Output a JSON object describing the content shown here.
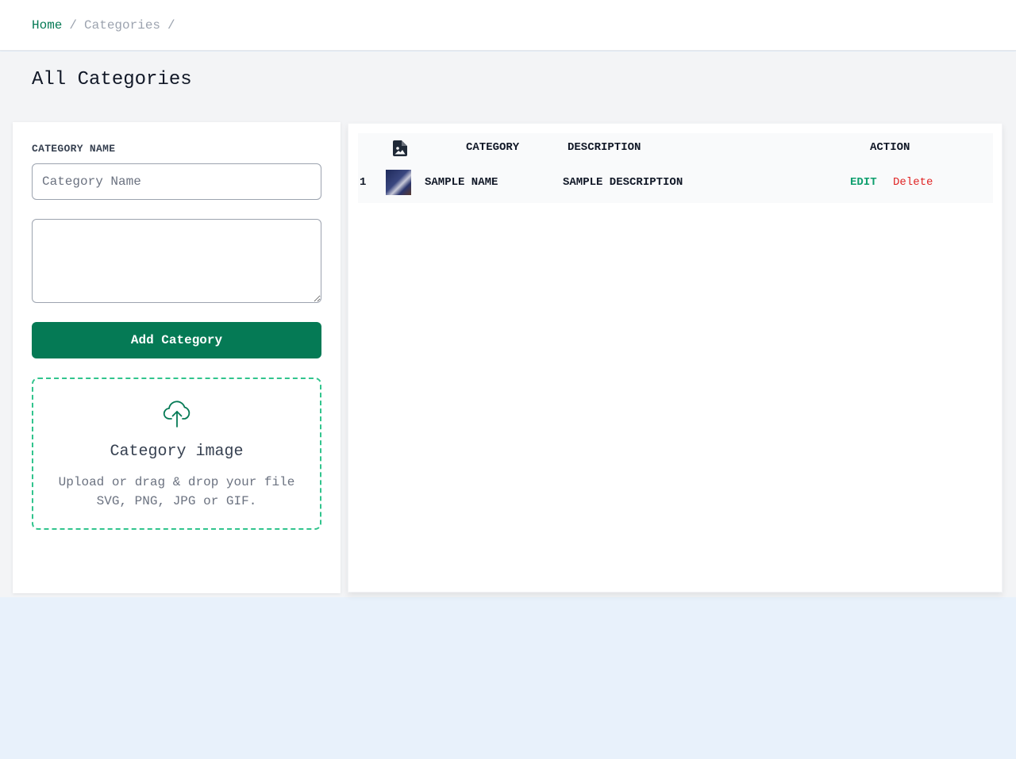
{
  "breadcrumb": {
    "home": "Home",
    "separator": "/",
    "current": "Categories"
  },
  "page": {
    "title": "All Categories"
  },
  "form": {
    "name_label": "CATEGORY NAME",
    "name_placeholder": "Category Name",
    "name_value": "",
    "description_value": "",
    "submit_label": "Add Category"
  },
  "upload": {
    "icon": "cloud-upload-icon",
    "title": "Category image",
    "hint_line1": "Upload or drag & drop your file",
    "hint_line2": "SVG, PNG, JPG or GIF."
  },
  "table": {
    "columns": {
      "image_icon": "image-file-icon",
      "category": "CATEGORY",
      "description": "DESCRIPTION",
      "action": "ACTION"
    },
    "rows": [
      {
        "index": "1",
        "name": "SAMPLE NAME",
        "description": "SAMPLE DESCRIPTION",
        "edit_label": "EDIT",
        "delete_label": "Delete"
      }
    ]
  },
  "colors": {
    "accent": "#057a55",
    "edit": "#0e9f6e",
    "delete": "#e02424",
    "dropzone_border": "#31c48d"
  }
}
